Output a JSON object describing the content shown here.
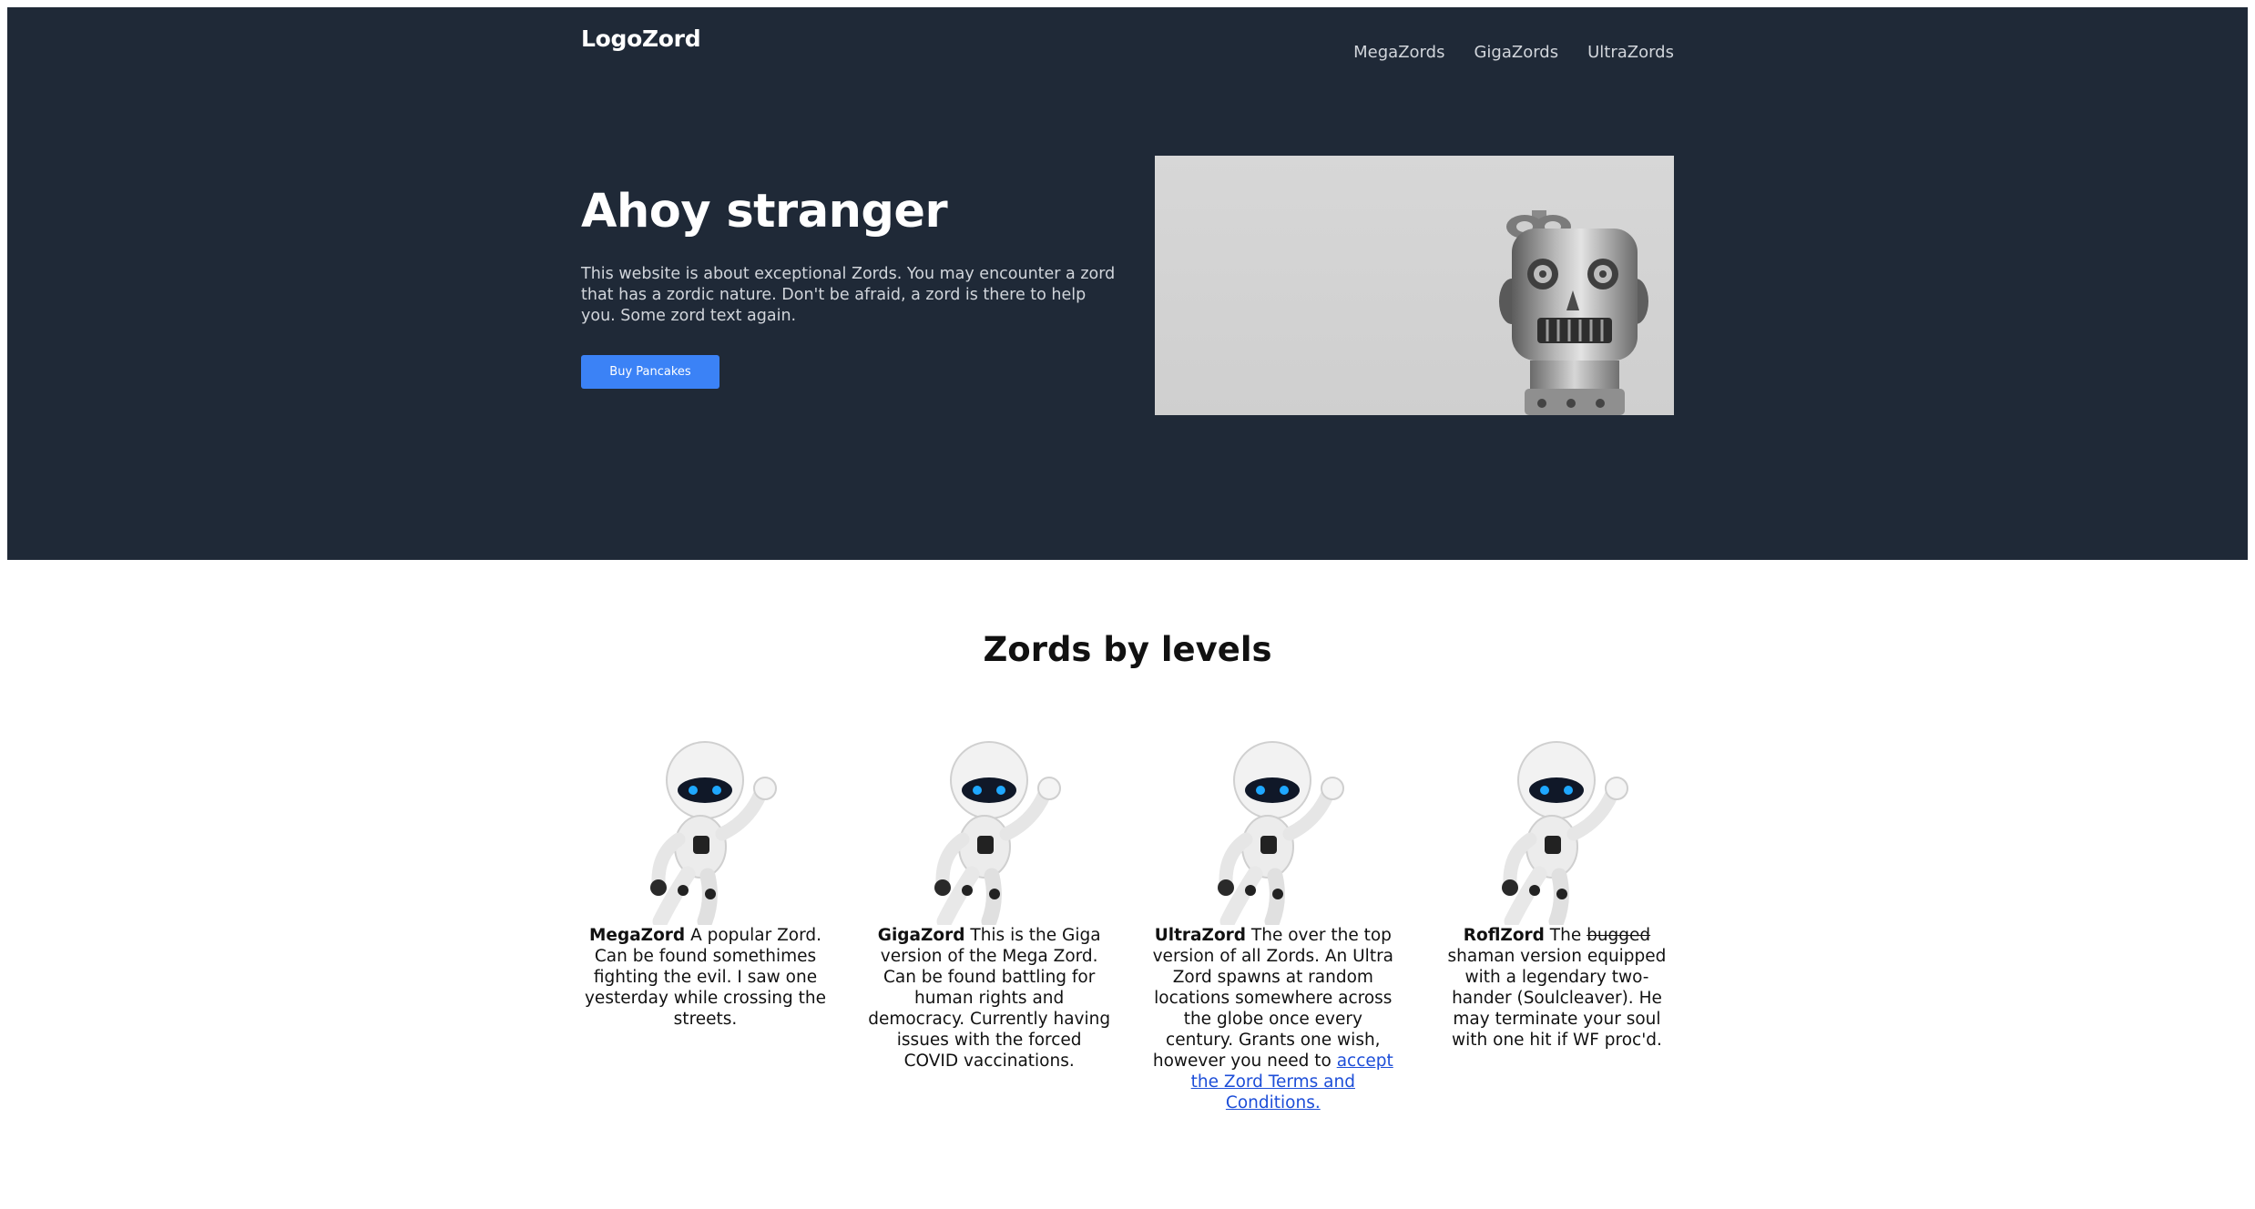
{
  "header": {
    "logo": "LogoZord",
    "nav": [
      "MegaZords",
      "GigaZords",
      "UltraZords"
    ]
  },
  "hero": {
    "title": "Ahoy stranger",
    "text": "This website is about exceptional Zords. You may encounter a zord that has a zordic nature. Don't be afraid, a zord is there to help you. Some zord text again.",
    "button_label": "Buy Pancakes"
  },
  "section": {
    "title": "Zords by levels"
  },
  "cards": [
    {
      "name": "MegaZord",
      "text": " A popular Zord. Can be found somethimes fighting the evil. I saw one yesterday while crossing the streets."
    },
    {
      "name": "GigaZord",
      "text": " This is the Giga version of the Mega Zord. Can be found battling for human rights and democracy. Currently having issues with the forced COVID vaccinations."
    },
    {
      "name": "UltraZord",
      "text": " The over the top version of all Zords. An Ultra Zord spawns at random locations somewhere across the globe once every century. Grants one wish, however you need to ",
      "link": "accept the Zord Terms and Conditions."
    },
    {
      "name": "RoflZord",
      "text_before": " The ",
      "strike": "bugged",
      "text_after": " shaman version equipped with a legendary two-hander (Soulcleaver). He may terminate your soul with one hit if WF proc'd."
    }
  ],
  "colors": {
    "hero_background": "#1f2937",
    "accent": "#3b82f6",
    "link": "#1d4ed8"
  }
}
